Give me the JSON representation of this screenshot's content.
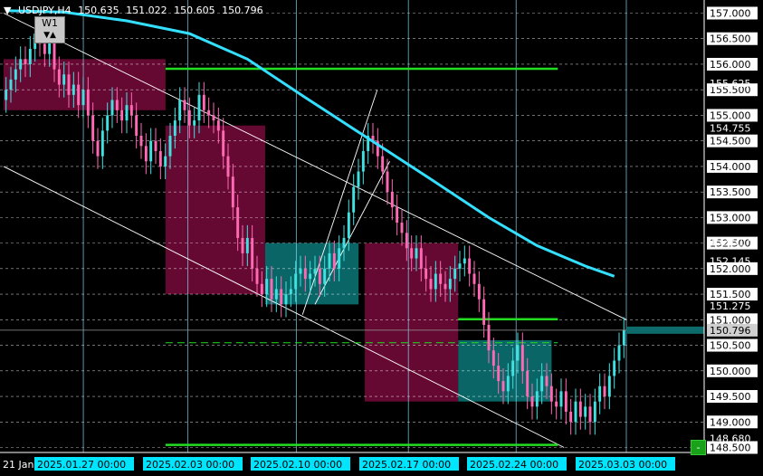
{
  "header": {
    "symbol": "USDJPY,H4",
    "open": "150.635",
    "high": "151.022",
    "low": "150.605",
    "close": "150.796"
  },
  "badge": "W1",
  "corner_button": "-",
  "colors": {
    "background": "#000000",
    "bull_candle": "#40e0e0",
    "bear_candle": "#ff69b4",
    "moving_average": "#33e0ff",
    "level_green": "#22dd22",
    "supply_zone": "#6b0a35",
    "demand_zone": "#0b6b6b",
    "grid": "#ffffff",
    "time_label_bg": "#00e5ff",
    "price_label_bg": "#ffffff"
  },
  "chart_data": {
    "type": "candlestick",
    "title": "USDJPY,H4",
    "ylim": [
      148.3,
      157.2
    ],
    "price_ticks": [
      "157.000",
      "156.500",
      "156.000",
      "155.500",
      "155.000",
      "154.500",
      "154.000",
      "153.500",
      "153.000",
      "152.500",
      "152.000",
      "151.500",
      "151.000",
      "150.500",
      "150.000",
      "149.500",
      "149.000",
      "148.500"
    ],
    "tick_values": [
      157.0,
      156.5,
      156.0,
      155.5,
      155.0,
      154.5,
      154.0,
      153.5,
      153.0,
      152.5,
      152.0,
      151.5,
      151.0,
      150.5,
      150.0,
      149.5,
      149.0,
      148.5
    ],
    "marked_prices": [
      {
        "label": "155.625",
        "value": 155.625
      },
      {
        "label": "154.755",
        "value": 154.755
      },
      {
        "label": "152.517",
        "value": 152.517
      },
      {
        "label": "152.145",
        "value": 152.145
      },
      {
        "label": "151.275",
        "value": 151.275
      },
      {
        "label": "150.796",
        "value": 150.796,
        "highlight": true
      },
      {
        "label": "148.680",
        "value": 148.68
      }
    ],
    "time_labels": [
      "21 Jan",
      "2025.01.27 00:00",
      "2025.02.03 00:00",
      "2025.02.10 00:00",
      "2025.02.17 00:00",
      "2025.02.24 00:00",
      "2025.03.03 00:00"
    ],
    "closes": [
      155.5,
      155.7,
      155.9,
      156.1,
      156.0,
      156.3,
      156.6,
      156.4,
      156.2,
      156.5,
      155.9,
      155.6,
      155.8,
      155.4,
      155.6,
      155.2,
      155.5,
      155.0,
      154.5,
      154.2,
      154.7,
      155.0,
      155.3,
      155.1,
      154.9,
      155.2,
      155.0,
      154.6,
      154.4,
      154.1,
      154.5,
      154.3,
      154.0,
      154.2,
      154.6,
      154.9,
      155.3,
      155.1,
      154.8,
      154.9,
      155.4,
      155.1,
      155.0,
      154.9,
      154.7,
      154.2,
      153.8,
      153.2,
      152.6,
      152.3,
      152.6,
      152.0,
      151.7,
      151.5,
      151.8,
      151.4,
      151.6,
      151.3,
      151.5,
      151.6,
      151.9,
      152.0,
      151.8,
      151.9,
      152.0,
      151.7,
      152.0,
      152.3,
      152.0,
      152.4,
      152.6,
      153.1,
      153.6,
      153.9,
      154.3,
      154.6,
      154.5,
      154.2,
      153.9,
      153.5,
      153.2,
      152.9,
      152.7,
      152.4,
      152.2,
      152.4,
      152.0,
      151.8,
      151.6,
      151.9,
      151.7,
      151.6,
      151.8,
      152.0,
      152.1,
      152.2,
      151.9,
      151.7,
      151.4,
      150.9,
      150.4,
      150.1,
      149.8,
      149.6,
      149.9,
      150.2,
      150.5,
      150.0,
      149.5,
      149.3,
      149.6,
      149.9,
      149.7,
      149.4,
      149.3,
      149.6,
      149.2,
      149.0,
      149.4,
      149.1,
      149.3,
      149.0,
      149.4,
      149.7,
      149.5,
      149.9,
      150.2,
      150.5,
      150.8
    ],
    "ma_points": [
      [
        0,
        157.05
      ],
      [
        12,
        157.02
      ],
      [
        25,
        156.85
      ],
      [
        38,
        156.6
      ],
      [
        50,
        156.1
      ],
      [
        62,
        155.35
      ],
      [
        75,
        154.55
      ],
      [
        88,
        153.75
      ],
      [
        100,
        153.0
      ],
      [
        110,
        152.45
      ],
      [
        120,
        152.05
      ],
      [
        126,
        151.85
      ]
    ],
    "green_levels": [
      {
        "price": 155.91,
        "from": 0.26,
        "to": 0.89
      },
      {
        "price": 151.01,
        "from": 0.73,
        "to": 0.89
      },
      {
        "price": 148.55,
        "from": 0.26,
        "to": 0.89
      }
    ],
    "green_dashed_level": {
      "price": 150.55,
      "from": 0.26,
      "to": 0.89
    },
    "zones": [
      {
        "kind": "supply",
        "from": 0.0,
        "to": 0.26,
        "top": 156.1,
        "bottom": 155.1
      },
      {
        "kind": "supply",
        "from": 0.26,
        "to": 0.42,
        "top": 154.8,
        "bottom": 151.5
      },
      {
        "kind": "demand",
        "from": 0.42,
        "to": 0.57,
        "top": 152.5,
        "bottom": 151.3
      },
      {
        "kind": "supply",
        "from": 0.58,
        "to": 0.73,
        "top": 152.5,
        "bottom": 149.4
      },
      {
        "kind": "demand",
        "from": 0.73,
        "to": 0.88,
        "top": 150.6,
        "bottom": 149.4
      }
    ]
  }
}
